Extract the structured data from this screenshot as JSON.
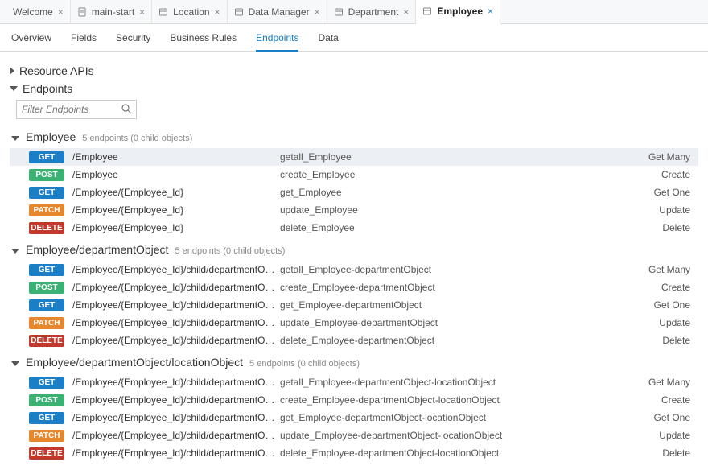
{
  "tabs": [
    {
      "label": "Welcome",
      "icon": null,
      "active": false
    },
    {
      "label": "main-start",
      "icon": "page",
      "active": false
    },
    {
      "label": "Location",
      "icon": "entity",
      "active": false
    },
    {
      "label": "Data Manager",
      "icon": "entity",
      "active": false
    },
    {
      "label": "Department",
      "icon": "entity",
      "active": false
    },
    {
      "label": "Employee",
      "icon": "entity",
      "active": true
    }
  ],
  "subtabs": [
    {
      "label": "Overview",
      "active": false
    },
    {
      "label": "Fields",
      "active": false
    },
    {
      "label": "Security",
      "active": false
    },
    {
      "label": "Business Rules",
      "active": false
    },
    {
      "label": "Endpoints",
      "active": true
    },
    {
      "label": "Data",
      "active": false
    }
  ],
  "sections": {
    "resource": {
      "title": "Resource APIs",
      "open": false
    },
    "endpoints": {
      "title": "Endpoints",
      "open": true
    }
  },
  "filter": {
    "placeholder": "Filter Endpoints"
  },
  "groups": [
    {
      "title": "Employee",
      "subtitle": "5 endpoints (0 child objects)",
      "rows": [
        {
          "method": "GET",
          "path": "/Employee",
          "op": "getall_Employee",
          "action": "Get Many",
          "selected": true
        },
        {
          "method": "POST",
          "path": "/Employee",
          "op": "create_Employee",
          "action": "Create"
        },
        {
          "method": "GET",
          "path": "/Employee/{Employee_Id}",
          "op": "get_Employee",
          "action": "Get One"
        },
        {
          "method": "PATCH",
          "path": "/Employee/{Employee_Id}",
          "op": "update_Employee",
          "action": "Update"
        },
        {
          "method": "DELETE",
          "path": "/Employee/{Employee_Id}",
          "op": "delete_Employee",
          "action": "Delete"
        }
      ]
    },
    {
      "title": "Employee/departmentObject",
      "subtitle": "5 endpoints (0 child objects)",
      "rows": [
        {
          "method": "GET",
          "path": "/Employee/{Employee_Id}/child/departmentObject",
          "op": "getall_Employee-departmentObject",
          "action": "Get Many"
        },
        {
          "method": "POST",
          "path": "/Employee/{Employee_Id}/child/departmentObject",
          "op": "create_Employee-departmentObject",
          "action": "Create"
        },
        {
          "method": "GET",
          "path": "/Employee/{Employee_Id}/child/departmentObject...",
          "op": "get_Employee-departmentObject",
          "action": "Get One"
        },
        {
          "method": "PATCH",
          "path": "/Employee/{Employee_Id}/child/departmentObject...",
          "op": "update_Employee-departmentObject",
          "action": "Update"
        },
        {
          "method": "DELETE",
          "path": "/Employee/{Employee_Id}/child/departmentObject...",
          "op": "delete_Employee-departmentObject",
          "action": "Delete"
        }
      ]
    },
    {
      "title": "Employee/departmentObject/locationObject",
      "subtitle": "5 endpoints (0 child objects)",
      "rows": [
        {
          "method": "GET",
          "path": "/Employee/{Employee_Id}/child/departmentObject...",
          "op": "getall_Employee-departmentObject-locationObject",
          "action": "Get Many"
        },
        {
          "method": "POST",
          "path": "/Employee/{Employee_Id}/child/departmentObject...",
          "op": "create_Employee-departmentObject-locationObject",
          "action": "Create"
        },
        {
          "method": "GET",
          "path": "/Employee/{Employee_Id}/child/departmentObject...",
          "op": "get_Employee-departmentObject-locationObject",
          "action": "Get One"
        },
        {
          "method": "PATCH",
          "path": "/Employee/{Employee_Id}/child/departmentObject...",
          "op": "update_Employee-departmentObject-locationObject",
          "action": "Update"
        },
        {
          "method": "DELETE",
          "path": "/Employee/{Employee_Id}/child/departmentObject...",
          "op": "delete_Employee-departmentObject-locationObject",
          "action": "Delete"
        }
      ]
    }
  ]
}
